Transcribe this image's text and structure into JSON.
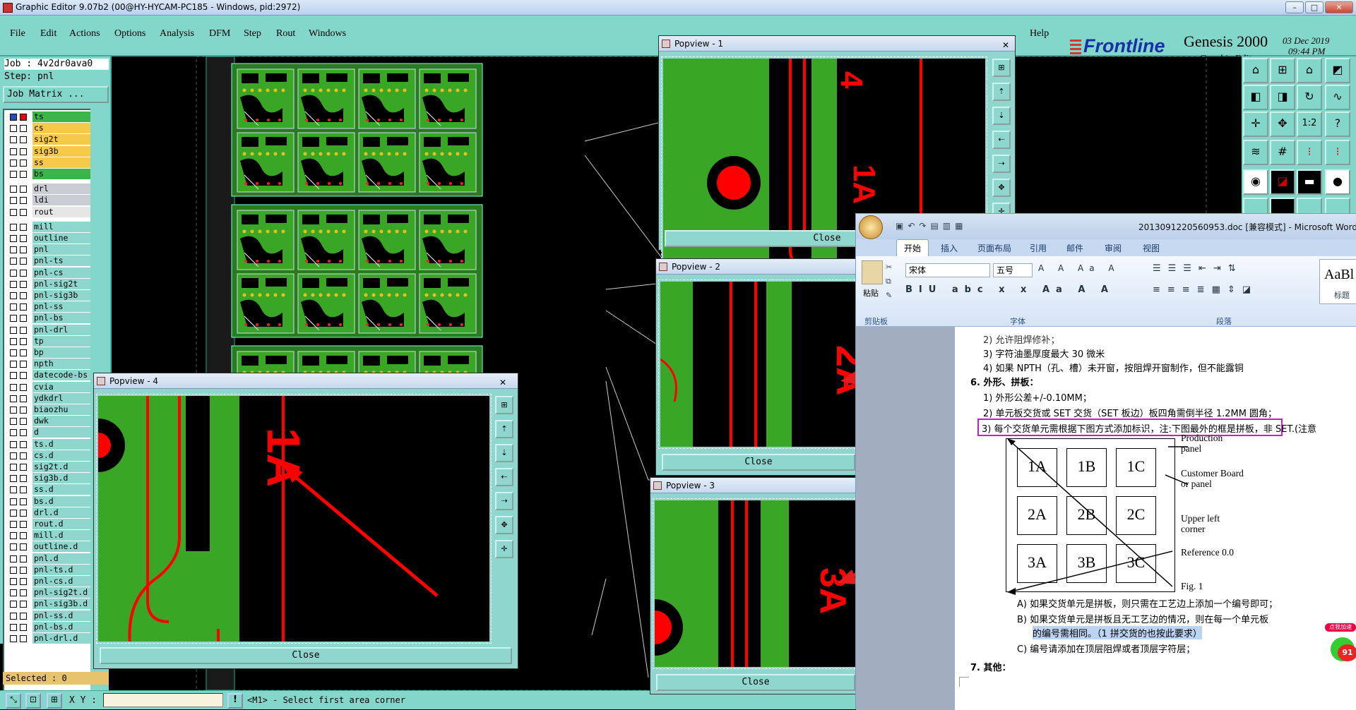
{
  "app": {
    "title": "Graphic Editor 9.07b2 (00@HY-HYCAM-PC185 - Windows, pid:2972)",
    "menu": [
      "File",
      "Edit",
      "Actions",
      "Options",
      "Analysis",
      "DFM",
      "Step",
      "Rout",
      "Windows"
    ],
    "menu_underline": [
      "F",
      "E",
      "A",
      "O",
      "A",
      "D",
      "S",
      "R",
      "W"
    ],
    "help": "Help",
    "brand": "Frontline",
    "product": "Genesis 2000",
    "product_sub": "Graphic Editor",
    "date": "03 Dec 2019",
    "time": "09:44 PM"
  },
  "left_panel": {
    "job": "Job : 4v2dr0ava0",
    "step": "Step: pnl",
    "job_matrix": "Job Matrix ...",
    "layers": [
      {
        "name": "ts",
        "color": "#39b54a",
        "checked": true
      },
      {
        "name": "cs",
        "color": "#f7c94a"
      },
      {
        "name": "sig2t",
        "color": "#f7c94a"
      },
      {
        "name": "sig3b",
        "color": "#f7c94a"
      },
      {
        "name": "ss",
        "color": "#f7c94a"
      },
      {
        "name": "bs",
        "color": "#39b54a"
      },
      {
        "name": "drl",
        "color": "#c9ccd3",
        "gap": true
      },
      {
        "name": "ldi",
        "color": "#c9ccd3"
      },
      {
        "name": "rout",
        "color": "#e6e6e6"
      },
      {
        "name": "mill",
        "color": "#8fd7ce",
        "gap": true
      },
      {
        "name": "outline",
        "color": "#8fd7ce"
      },
      {
        "name": "pnl",
        "color": "#8fd7ce"
      },
      {
        "name": "pnl-ts",
        "color": "#8fd7ce"
      },
      {
        "name": "pnl-cs",
        "color": "#8fd7ce"
      },
      {
        "name": "pnl-sig2t",
        "color": "#8fd7ce"
      },
      {
        "name": "pnl-sig3b",
        "color": "#8fd7ce"
      },
      {
        "name": "pnl-ss",
        "color": "#8fd7ce"
      },
      {
        "name": "pnl-bs",
        "color": "#8fd7ce"
      },
      {
        "name": "pnl-drl",
        "color": "#8fd7ce"
      },
      {
        "name": "tp",
        "color": "#8fd7ce"
      },
      {
        "name": "bp",
        "color": "#8fd7ce"
      },
      {
        "name": "npth",
        "color": "#8fd7ce"
      },
      {
        "name": "datecode-bs",
        "color": "#8fd7ce"
      },
      {
        "name": "cvia",
        "color": "#8fd7ce"
      },
      {
        "name": "ydkdrl",
        "color": "#8fd7ce"
      },
      {
        "name": "biaozhu",
        "color": "#8fd7ce"
      },
      {
        "name": "dwk",
        "color": "#8fd7ce"
      },
      {
        "name": "d",
        "color": "#8fd7ce"
      },
      {
        "name": "ts.d",
        "color": "#8fd7ce"
      },
      {
        "name": "cs.d",
        "color": "#8fd7ce"
      },
      {
        "name": "sig2t.d",
        "color": "#8fd7ce"
      },
      {
        "name": "sig3b.d",
        "color": "#8fd7ce"
      },
      {
        "name": "ss.d",
        "color": "#8fd7ce"
      },
      {
        "name": "bs.d",
        "color": "#8fd7ce"
      },
      {
        "name": "drl.d",
        "color": "#8fd7ce"
      },
      {
        "name": "rout.d",
        "color": "#8fd7ce"
      },
      {
        "name": "mill.d",
        "color": "#8fd7ce"
      },
      {
        "name": "outline.d",
        "color": "#8fd7ce"
      },
      {
        "name": "pnl.d",
        "color": "#8fd7ce"
      },
      {
        "name": "pnl-ts.d",
        "color": "#8fd7ce"
      },
      {
        "name": "pnl-cs.d",
        "color": "#8fd7ce"
      },
      {
        "name": "pnl-sig2t.d",
        "color": "#8fd7ce"
      },
      {
        "name": "pnl-sig3b.d",
        "color": "#8fd7ce"
      },
      {
        "name": "pnl-ss.d",
        "color": "#8fd7ce"
      },
      {
        "name": "pnl-bs.d",
        "color": "#8fd7ce"
      },
      {
        "name": "pnl-drl.d",
        "color": "#8fd7ce"
      }
    ],
    "selected": "Selected : 0"
  },
  "status": {
    "xy_label": "X Y :",
    "message": "<M1> - Select first area corner"
  },
  "popviews": [
    {
      "title": "Popview - 1",
      "close": "Close",
      "labels": [
        "4",
        "1A"
      ]
    },
    {
      "title": "Popview - 2",
      "close": "Close",
      "labels": [
        "2A"
      ]
    },
    {
      "title": "Popview - 3",
      "close": "Close",
      "labels": [
        "3A"
      ]
    },
    {
      "title": "Popview - 4",
      "close": "Close",
      "labels": [
        "1A"
      ]
    }
  ],
  "word": {
    "title": "2013091220560953.doc [兼容模式] - Microsoft Word",
    "tabs": [
      "开始",
      "插入",
      "页面布局",
      "引用",
      "邮件",
      "审阅",
      "视图"
    ],
    "font": "宋体",
    "size": "五号",
    "groups": [
      "剪贴板",
      "字体",
      "段落"
    ],
    "paste": "粘贴",
    "style_preview": "AaBl",
    "style_name": "标题",
    "lines": [
      "2)  允许阻焊修补；",
      "3)  字符油墨厚度最大 30 微米",
      "4)  如果 NPTH（孔、槽）未开窗，按阻焊开窗制作，但不能露铜",
      "6.   外形、拼板：",
      "1)  外形公差+/-0.10MM；",
      "2)  单元板交货或 SET 交货（SET 板边）板四角需倒半径 1.2MM 圆角；",
      "3)  每个交货单元需根据下图方式添加标识，注:下图最外的框是拼板，非 SET.(注意",
      "A)  如果交货单元是拼板，则只需在工艺边上添加一个编号即可；",
      "B)  如果交货单元是拼板且无工艺边的情况，则在每一个单元板",
      "的编号需相同。（1 拼交货的也按此要求）",
      "C)  编号请添加在顶层阻焊或者顶层字符层；",
      "7.   其他："
    ],
    "figure": {
      "cells": [
        "1A",
        "1B",
        "1C",
        "2A",
        "2B",
        "2C",
        "3A",
        "3B",
        "3C"
      ],
      "labels": [
        "Production panel",
        "Customer Board or panel",
        "Upper left corner",
        "Reference 0.0",
        "Fig. 1"
      ]
    },
    "badge": "91",
    "badge_text": "点我加速"
  }
}
